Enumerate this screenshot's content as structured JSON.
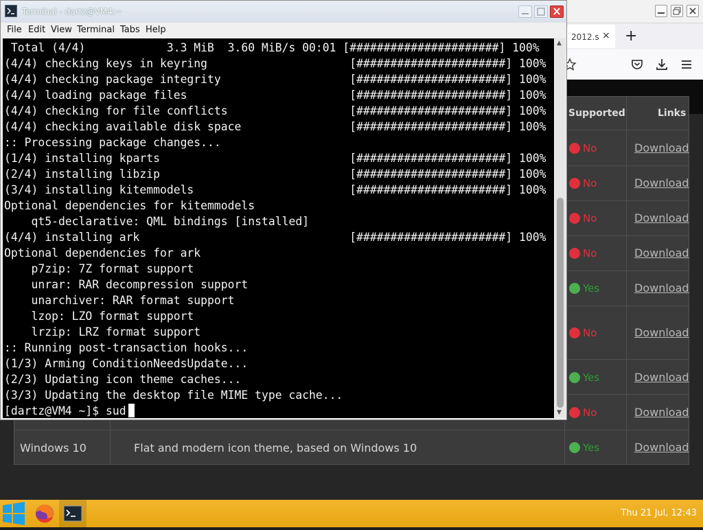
{
  "terminal": {
    "title": "Terminal - dartz@VM4:~",
    "menu": [
      "File",
      "Edit",
      "View",
      "Terminal",
      "Tabs",
      "Help"
    ],
    "lines": [
      " Total (4/4)            3.3 MiB  3.60 MiB/s 00:01 [######################] 100%",
      "(4/4) checking keys in keyring                     [######################] 100%",
      "(4/4) checking package integrity                   [######################] 100%",
      "(4/4) loading package files                        [######################] 100%",
      "(4/4) checking for file conflicts                  [######################] 100%",
      "(4/4) checking available disk space                [######################] 100%",
      ":: Processing package changes...",
      "(1/4) installing kparts                            [######################] 100%",
      "(2/4) installing libzip                            [######################] 100%",
      "(3/4) installing kitemmodels                       [######################] 100%",
      "Optional dependencies for kitemmodels",
      "    qt5-declarative: QML bindings [installed]",
      "(4/4) installing ark                               [######################] 100%",
      "Optional dependencies for ark",
      "    p7zip: 7Z format support",
      "    unrar: RAR decompression support",
      "    unarchiver: RAR format support",
      "    lzop: LZO format support",
      "    lrzip: LRZ format support",
      ":: Running post-transaction hooks...",
      "(1/3) Arming ConditionNeedsUpdate...",
      "(2/3) Updating icon theme caches...",
      "(3/3) Updating the desktop file MIME type cache...",
      "[dartz@VM4 ~]$ sud"
    ]
  },
  "browser": {
    "tab_label": "2012.s",
    "table": {
      "headers": {
        "supported": "Supported",
        "links": "Links"
      },
      "rows": [
        {
          "supported": "No",
          "link": "Download"
        },
        {
          "supported": "No",
          "link": "Download"
        },
        {
          "supported": "No",
          "link": "Download"
        },
        {
          "supported": "No",
          "link": "Download"
        },
        {
          "supported": "Yes",
          "link": "Download"
        },
        {
          "supported": "No",
          "link": "Download"
        },
        {
          "supported": "Yes",
          "link": "Download"
        },
        {
          "supported": "No",
          "link": "Download"
        },
        {
          "supported": "Yes",
          "link": "Download",
          "name": "Windows 10",
          "description": "Flat and modern icon theme, based on Windows 10"
        }
      ]
    },
    "colors": {
      "no": "#e0303b",
      "yes": "#4caf50",
      "no_text": "#e0303b",
      "yes_text": "#2e9e36"
    }
  },
  "taskbar": {
    "clock": "Thu 21 Jul, 12:43",
    "apps": [
      "windows-start-icon",
      "firefox-icon",
      "terminal-icon"
    ]
  }
}
